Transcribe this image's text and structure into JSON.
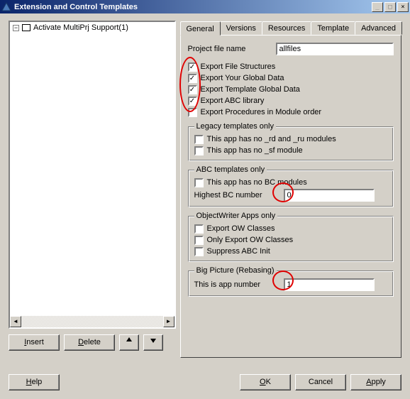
{
  "window": {
    "title": "Extension and Control Templates",
    "buttons": {
      "min": "_",
      "max": "□",
      "close": "×"
    }
  },
  "tree": {
    "root_label": "Activate MultiPrj Support(1)"
  },
  "left_buttons": {
    "insert": "Insert",
    "delete": "Delete"
  },
  "tabs": [
    "General",
    "Versions",
    "Resources",
    "Template",
    "Advanced"
  ],
  "general": {
    "project_file_label": "Project file name",
    "project_file_value": "allfiles",
    "checks": [
      {
        "label": "Export File Structures",
        "checked": true
      },
      {
        "label": "Export Your Global Data",
        "checked": true
      },
      {
        "label": "Export Template Global Data",
        "checked": true
      },
      {
        "label": "Export ABC library",
        "checked": true
      },
      {
        "label": "Export Procedures in Module order",
        "checked": false
      }
    ],
    "legacy": {
      "legend": "Legacy templates only",
      "checks": [
        {
          "label": "This app has no _rd and _ru modules",
          "checked": false
        },
        {
          "label": "This app has no _sf module",
          "checked": false
        }
      ]
    },
    "abc": {
      "legend": "ABC templates only",
      "check": {
        "label": "This app has no BC modules",
        "checked": false
      },
      "highest_label": "Highest BC number",
      "highest_value": "0"
    },
    "ow": {
      "legend": "ObjectWriter Apps only",
      "checks": [
        {
          "label": "Export OW Classes",
          "checked": false
        },
        {
          "label": "Only Export OW Classes",
          "checked": false
        },
        {
          "label": "Suppress ABC Init",
          "checked": false
        }
      ]
    },
    "bp": {
      "legend": "Big Picture (Rebasing)",
      "label": "This is app number",
      "value": "1"
    }
  },
  "dialog_buttons": {
    "help": "Help",
    "ok": "OK",
    "cancel": "Cancel",
    "apply": "Apply"
  }
}
